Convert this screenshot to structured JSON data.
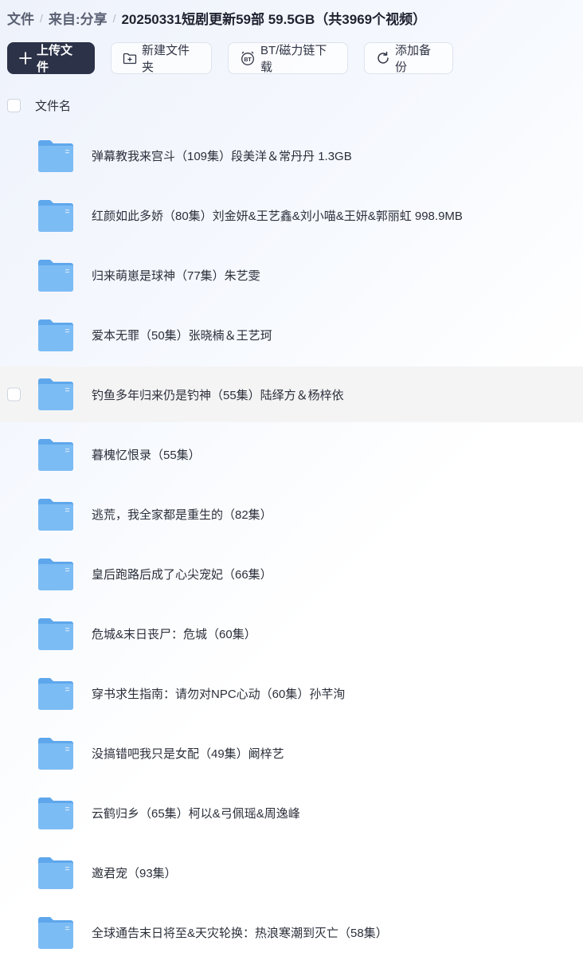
{
  "breadcrumb": {
    "root": "文件",
    "from": "来自:",
    "share": "分享",
    "current": "20250331短剧更新59部 59.5GB（共3969个视频）"
  },
  "toolbar": {
    "upload": "上传文件",
    "new_folder": "新建文件夹",
    "bt": "BT/磁力链下载",
    "backup": "添加备份"
  },
  "list_header": {
    "name": "文件名"
  },
  "files": [
    "弹幕教我来宫斗（109集）段美洋＆常丹丹 1.3GB",
    "红颜如此多娇（80集）刘金妍&王艺鑫&刘小喵&王妍&郭丽虹 998.9MB",
    "归来萌崽是球神（77集）朱艺雯",
    "爱本无罪（50集）张晓楠＆王艺珂",
    "钓鱼多年归来仍是钓神（55集）陆绎方＆杨梓依",
    "暮槐忆恨录（55集）",
    "逃荒，我全家都是重生的（82集）",
    "皇后跑路后成了心尖宠妃（66集）",
    "危城&末日丧尸：危城（60集）",
    "穿书求生指南：请勿对NPC心动（60集）孙芊洵",
    "没搞错吧我只是女配（49集）阚梓艺",
    "云鹤归乡（65集）柯以&弓佩瑶&周逸峰",
    "邀君宠（93集）",
    "全球通告末日将至&天灾轮换：热浪寒潮到灭亡（58集）"
  ],
  "hovered_index": 4,
  "colors": {
    "primary_button": "#2c3248",
    "folder_front": "#7cbcf4",
    "folder_back": "#5ea7ec"
  }
}
